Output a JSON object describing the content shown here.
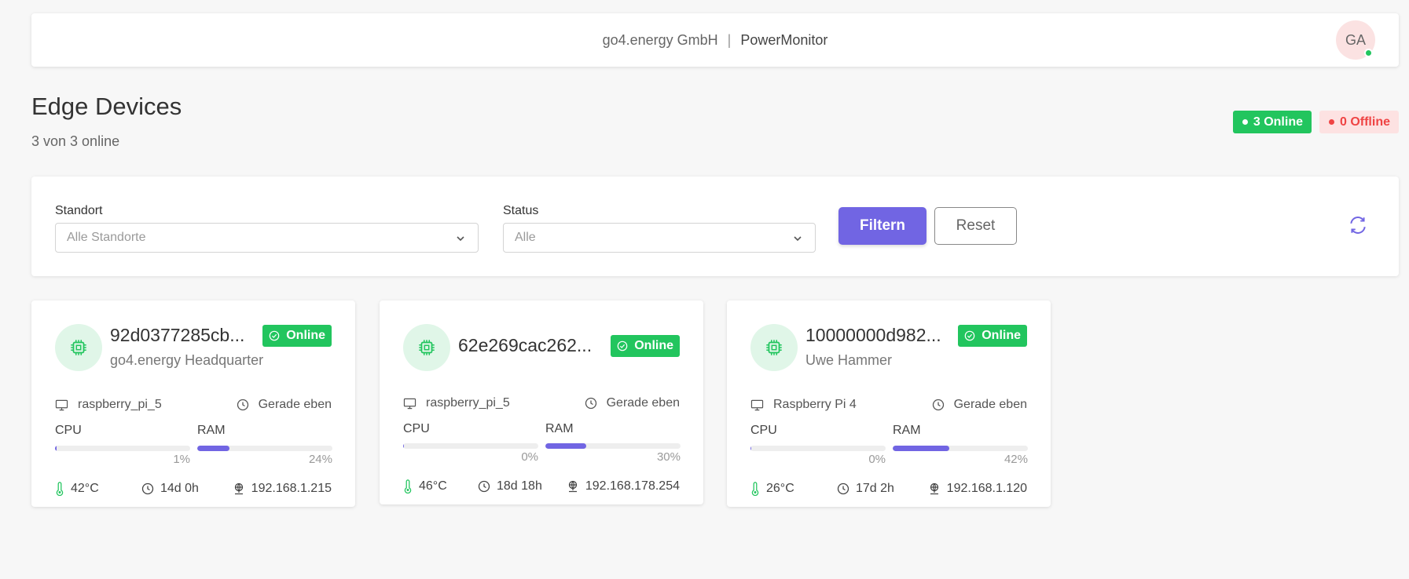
{
  "header": {
    "company": "go4.energy GmbH",
    "separator": "|",
    "product": "PowerMonitor",
    "avatar_initials": "GA"
  },
  "page": {
    "title": "Edge Devices",
    "subtitle": "3 von 3 online"
  },
  "summary": {
    "online_label": "3 Online",
    "offline_label": "0 Offline"
  },
  "filters": {
    "location_label": "Standort",
    "location_value": "Alle Standorte",
    "status_label": "Status",
    "status_value": "Alle",
    "filter_button": "Filtern",
    "reset_button": "Reset"
  },
  "labels": {
    "cpu": "CPU",
    "ram": "RAM",
    "status_online": "Online",
    "last_seen": "Gerade eben"
  },
  "devices": [
    {
      "name": "92d0377285cb...",
      "location": "go4.energy Headquarter",
      "model": "raspberry_pi_5",
      "cpu_pct": 1,
      "cpu_text": "1%",
      "ram_pct": 24,
      "ram_text": "24%",
      "temp": "42°C",
      "uptime": "14d 0h",
      "ip": "192.168.1.215"
    },
    {
      "name": "62e269cac262...",
      "location": "",
      "model": "raspberry_pi_5",
      "cpu_pct": 0,
      "cpu_text": "0%",
      "ram_pct": 30,
      "ram_text": "30%",
      "temp": "46°C",
      "uptime": "18d 18h",
      "ip": "192.168.178.254"
    },
    {
      "name": "10000000d982...",
      "location": "Uwe Hammer",
      "model": "Raspberry Pi 4",
      "cpu_pct": 0,
      "cpu_text": "0%",
      "ram_pct": 42,
      "ram_text": "42%",
      "temp": "26°C",
      "uptime": "17d 2h",
      "ip": "192.168.1.120"
    }
  ],
  "colors": {
    "accent": "#7165e3",
    "online": "#22c55e",
    "offline": "#ef4444"
  }
}
